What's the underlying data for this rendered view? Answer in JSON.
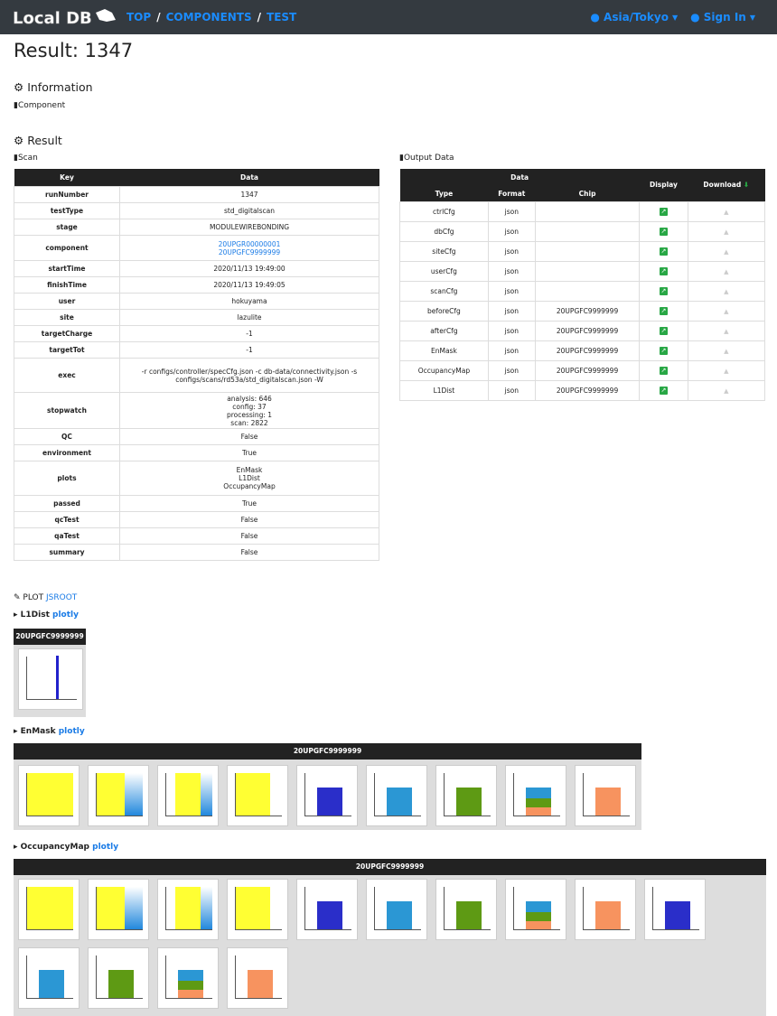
{
  "nav": {
    "logo_text": "Local DB",
    "crumbs": [
      "TOP",
      "COMPONENTS",
      "TEST"
    ],
    "separator": "/",
    "timezone": "Asia/Tokyo",
    "signin": "Sign In"
  },
  "page_title": "Result: 1347",
  "info": {
    "heading": "Information",
    "component_label": "Component"
  },
  "result": {
    "heading": "Result",
    "scan_label": "Scan",
    "output_label": "Output Data",
    "scan_headers": [
      "Key",
      "Data"
    ],
    "rows": [
      {
        "k": "runNumber",
        "v": "1347"
      },
      {
        "k": "testType",
        "v": "std_digitalscan"
      },
      {
        "k": "stage",
        "v": "MODULEWIREBONDING"
      },
      {
        "k": "component",
        "v": "20UPGR00000001\n20UPGFC9999999",
        "link": true
      },
      {
        "k": "startTime",
        "v": "2020/11/13 19:49:00"
      },
      {
        "k": "finishTime",
        "v": "2020/11/13 19:49:05"
      },
      {
        "k": "user",
        "v": "hokuyama"
      },
      {
        "k": "site",
        "v": "lazulite"
      },
      {
        "k": "targetCharge",
        "v": "-1"
      },
      {
        "k": "targetTot",
        "v": "-1"
      },
      {
        "k": "exec",
        "v": "-r configs/controller/specCfg.json -c db-data/connectivity.json -s configs/scans/rd53a/std_digitalscan.json -W"
      },
      {
        "k": "stopwatch",
        "v": "analysis: 646\nconfig: 37\nprocessing: 1\nscan: 2822"
      },
      {
        "k": "QC",
        "v": "False"
      },
      {
        "k": "environment",
        "v": "True"
      },
      {
        "k": "plots",
        "v": "EnMask\nL1Dist\nOccupancyMap"
      },
      {
        "k": "passed",
        "v": "True"
      },
      {
        "k": "qcTest",
        "v": "False"
      },
      {
        "k": "qaTest",
        "v": "False"
      },
      {
        "k": "summary",
        "v": "False"
      }
    ],
    "output_headers": {
      "group": "Data",
      "type": "Type",
      "format": "Format",
      "chip": "Chip",
      "display": "Display",
      "download": "Download"
    },
    "outputs": [
      {
        "type": "ctrlCfg",
        "format": "json",
        "chip": ""
      },
      {
        "type": "dbCfg",
        "format": "json",
        "chip": ""
      },
      {
        "type": "siteCfg",
        "format": "json",
        "chip": ""
      },
      {
        "type": "userCfg",
        "format": "json",
        "chip": ""
      },
      {
        "type": "scanCfg",
        "format": "json",
        "chip": ""
      },
      {
        "type": "beforeCfg",
        "format": "json",
        "chip": "20UPGFC9999999"
      },
      {
        "type": "afterCfg",
        "format": "json",
        "chip": "20UPGFC9999999"
      },
      {
        "type": "EnMask",
        "format": "json",
        "chip": "20UPGFC9999999"
      },
      {
        "type": "OccupancyMap",
        "format": "json",
        "chip": "20UPGFC9999999"
      },
      {
        "type": "L1Dist",
        "format": "json",
        "chip": "20UPGFC9999999"
      }
    ]
  },
  "plot": {
    "heading": "PLOT",
    "jsroot": "JSROOT",
    "plotly": "plotly",
    "sections": [
      {
        "name": "L1Dist",
        "chip": "20UPGFC9999999"
      },
      {
        "name": "EnMask",
        "chip": "20UPGFC9999999"
      },
      {
        "name": "OccupancyMap",
        "chip": "20UPGFC9999999"
      }
    ]
  },
  "colors": {
    "link": "#1a7be6",
    "navbar": "#343a40",
    "display_icon": "#28a745"
  }
}
